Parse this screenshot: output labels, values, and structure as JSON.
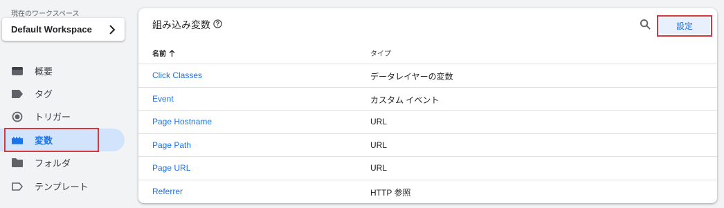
{
  "sidebar": {
    "workspace_label": "現在のワークスペース",
    "workspace_name": "Default Workspace",
    "items": [
      {
        "label": "概要",
        "icon": "overview-icon"
      },
      {
        "label": "タグ",
        "icon": "tag-icon"
      },
      {
        "label": "トリガー",
        "icon": "trigger-icon"
      },
      {
        "label": "変数",
        "icon": "variable-icon",
        "active": true
      },
      {
        "label": "フォルダ",
        "icon": "folder-icon"
      },
      {
        "label": "テンプレート",
        "icon": "template-icon"
      }
    ]
  },
  "card": {
    "title": "組み込み変数",
    "settings_label": "設定",
    "columns": {
      "name": "名前",
      "type": "タイプ"
    },
    "rows": [
      {
        "name": "Click Classes",
        "type": "データレイヤーの変数"
      },
      {
        "name": "Event",
        "type": "カスタム イベント"
      },
      {
        "name": "Page Hostname",
        "type": "URL"
      },
      {
        "name": "Page Path",
        "type": "URL"
      },
      {
        "name": "Page URL",
        "type": "URL"
      },
      {
        "name": "Referrer",
        "type": "HTTP 参照"
      }
    ]
  },
  "colors": {
    "accent": "#1a73e8",
    "active_bg": "#d2e3fc",
    "highlight": "#d0393d"
  }
}
